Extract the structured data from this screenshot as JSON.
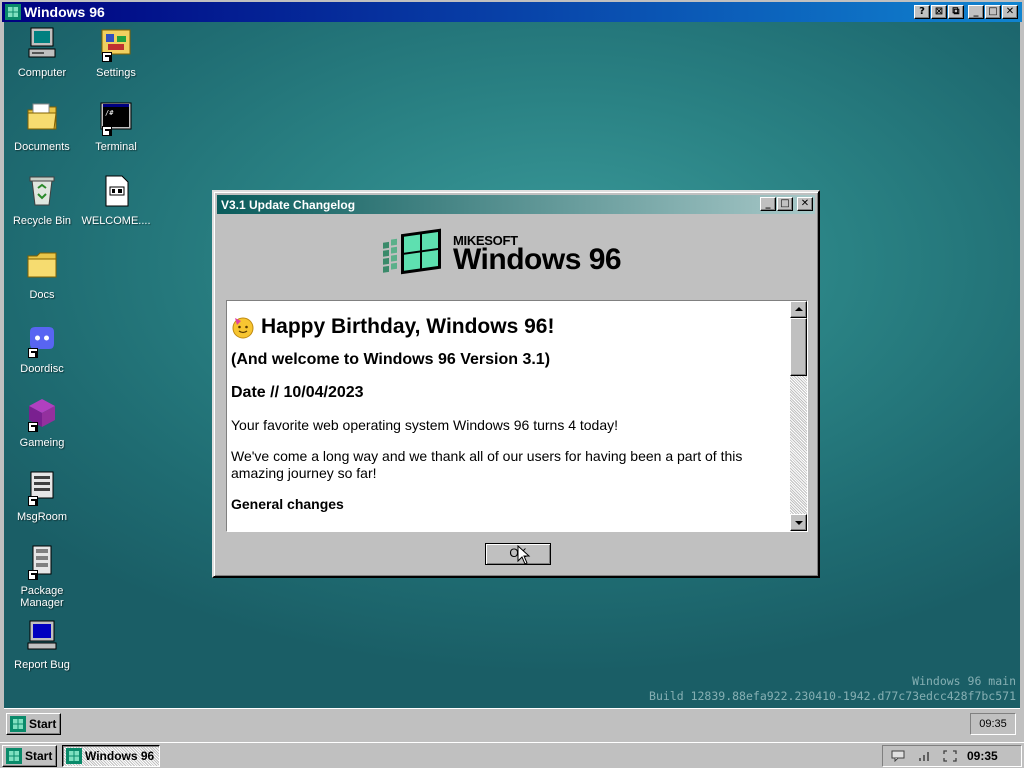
{
  "outer_window": {
    "title": "Windows 96",
    "buttons": [
      "?",
      "⊠",
      "⧉",
      "_",
      "□",
      "✕"
    ]
  },
  "desktop": {
    "icons": [
      {
        "label": "Computer"
      },
      {
        "label": "Settings"
      },
      {
        "label": "Documents"
      },
      {
        "label": "Terminal"
      },
      {
        "label": "Recycle Bin"
      },
      {
        "label": "WELCOME...."
      },
      {
        "label": "Docs"
      },
      {
        "label": "Doordisc"
      },
      {
        "label": "Gameing"
      },
      {
        "label": "MsgRoom"
      },
      {
        "label": "Package Manager"
      },
      {
        "label": "Report Bug"
      }
    ],
    "build_info": {
      "line1": "Windows 96 main",
      "line2": "Build 12839.88efa922.230410-1942.d77c73edcc428f7bc571"
    }
  },
  "dialog": {
    "title": "V3.1 Update Changelog",
    "logo": {
      "brand": "MIKESOFT",
      "product": "Windows 96"
    },
    "content": {
      "heading": "Happy Birthday, Windows 96!",
      "subheading": "(And welcome to Windows 96 Version 3.1)",
      "date": "Date // 10/04/2023",
      "para1": "Your favorite web operating system Windows 96 turns 4 today!",
      "para2": "We've come a long way and we thank all of our users for having been a part of this amazing journey so far!",
      "section": "General changes"
    },
    "ok_label": "OK"
  },
  "inner_taskbar": {
    "start_label": "Start",
    "clock": "09:35"
  },
  "outer_taskbar": {
    "start_label": "Start",
    "task_label": "Windows 96",
    "clock": "09:35"
  },
  "colors": {
    "desktop": "#2a8284",
    "title_active": "#000080",
    "dialog_title": "#0a5c5c",
    "face": "#c0c0c0"
  }
}
